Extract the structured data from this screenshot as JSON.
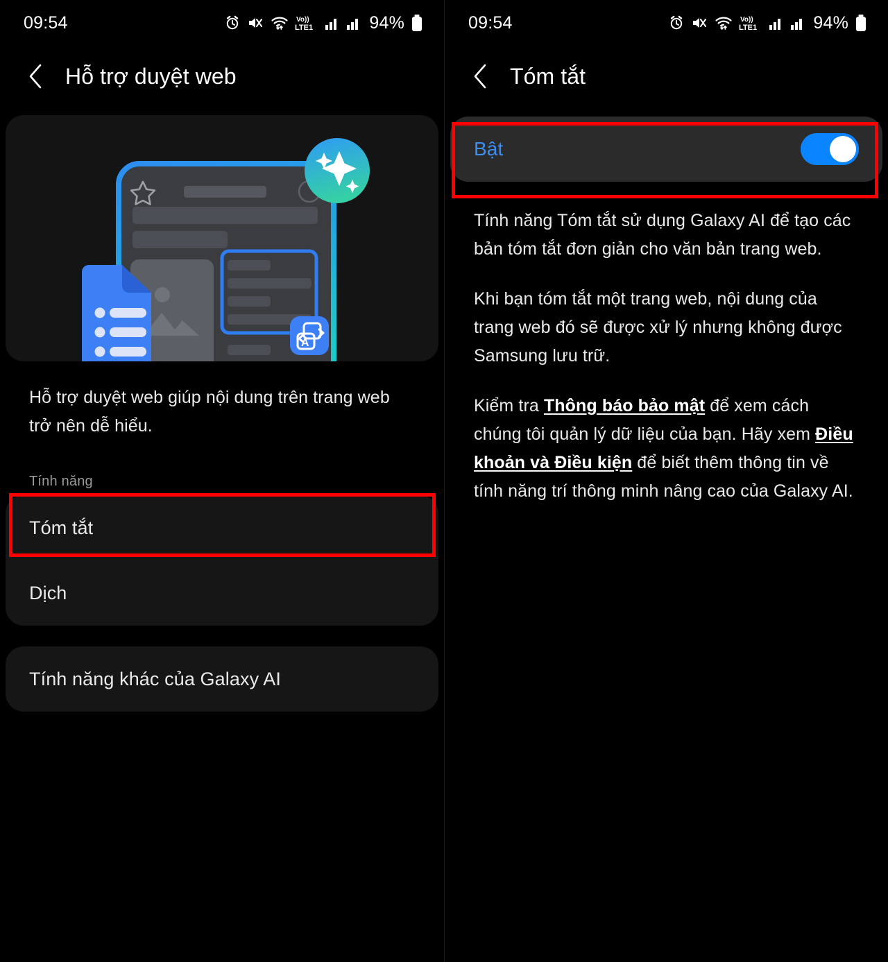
{
  "status_bar": {
    "time": "09:54",
    "battery_text": "94%",
    "icons": [
      "alarm-icon",
      "mute-vibrate-icon",
      "wifi-icon",
      "volte-icon",
      "signal-bars-icon",
      "signal-bars-icon",
      "battery-icon"
    ],
    "network_label": "Vo))",
    "network_sub": "LTE1"
  },
  "left_screen": {
    "appbar": {
      "title": "Hỗ trợ duyệt web",
      "back_icon": "chevron-left-icon"
    },
    "hero": {
      "illustration_name": "browsing-assist-illustration",
      "icons": [
        "sparkle-badge-icon",
        "summary-document-icon",
        "translate-icon",
        "image-placeholder-icon",
        "star-outline-icon"
      ],
      "colors": {
        "phone_border_top": "#2d8df0",
        "phone_border_bottom": "#1fc8c8",
        "badge_top": "#2e9bf5",
        "badge_bottom": "#35d0a5",
        "doc_blue": "#3d7ff5",
        "highlight_blue": "#2f7df0"
      }
    },
    "description": "Hỗ trợ duyệt web giúp nội dung trên trang web trở nên dễ hiểu.",
    "section_label": "Tính năng",
    "feature_rows": [
      {
        "label": "Tóm tắt",
        "highlighted": true
      },
      {
        "label": "Dịch",
        "highlighted": false
      }
    ],
    "other_row": {
      "label": "Tính năng khác của Galaxy AI"
    },
    "annotation_color": "#ff0000"
  },
  "right_screen": {
    "appbar": {
      "title": "Tóm tắt",
      "back_icon": "chevron-left-icon"
    },
    "toggle": {
      "label": "Bật",
      "state": "on",
      "accent": "#0a84ff",
      "label_color": "#3a8ef6"
    },
    "paragraphs": [
      {
        "parts": [
          {
            "text": "Tính năng Tóm tắt sử dụng Galaxy AI để tạo các bản tóm tắt đơn giản cho văn bản trang web.",
            "link": false
          }
        ]
      },
      {
        "parts": [
          {
            "text": "Khi bạn tóm tắt một trang web, nội dung của trang web đó sẽ được xử lý nhưng không được Samsung lưu trữ.",
            "link": false
          }
        ]
      },
      {
        "parts": [
          {
            "text": "Kiểm tra ",
            "link": false
          },
          {
            "text": "Thông báo bảo mật",
            "link": true
          },
          {
            "text": " để xem cách chúng tôi quản lý dữ liệu của bạn. Hãy xem ",
            "link": false
          },
          {
            "text": "Điều khoản và Điều kiện",
            "link": true
          },
          {
            "text": " để biết thêm thông tin về tính năng trí thông minh nâng cao của Galaxy AI.",
            "link": false
          }
        ]
      }
    ],
    "annotation_color": "#ff0000"
  }
}
